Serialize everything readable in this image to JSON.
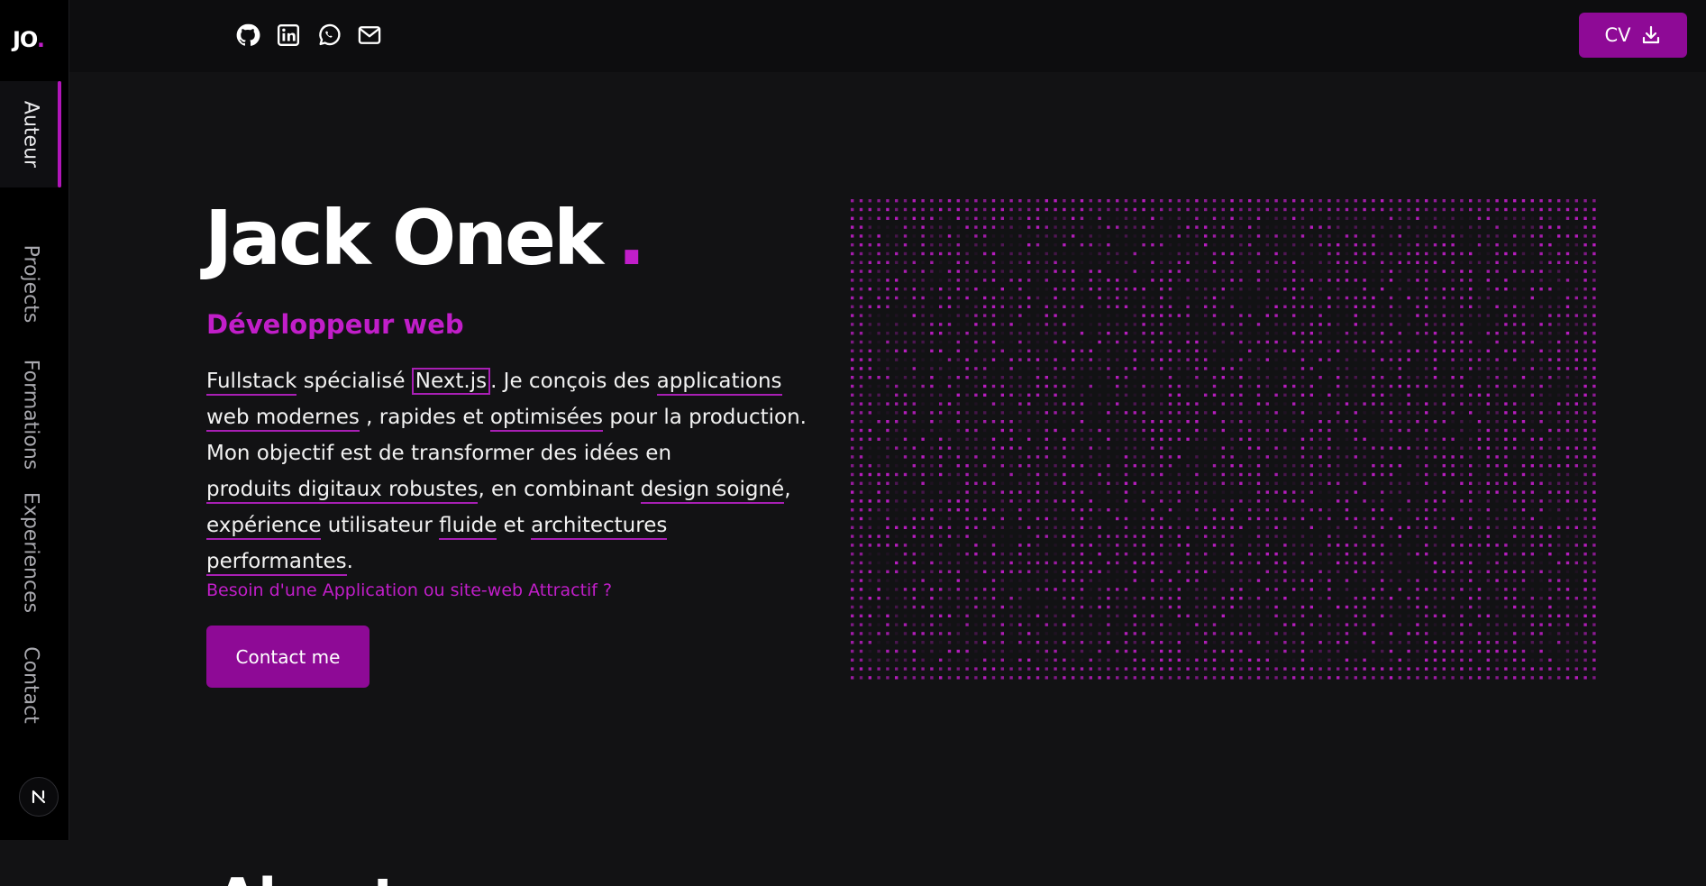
{
  "logo": {
    "text": "JO",
    "dot": "."
  },
  "sidebar": {
    "items": [
      {
        "label": "Auteur",
        "active": true
      },
      {
        "label": "Projects",
        "active": false
      },
      {
        "label": "Formations",
        "active": false
      },
      {
        "label": "Experiences",
        "active": false
      },
      {
        "label": "Contact",
        "active": false
      }
    ],
    "theme_toggle_icon": "nextjs-icon"
  },
  "header": {
    "social_icons": [
      "github-icon",
      "linkedin-icon",
      "whatsapp-icon",
      "mail-icon"
    ],
    "cv_label": "CV",
    "cv_icon": "download-icon"
  },
  "hero": {
    "name": "Jack Onek",
    "name_dot": ".",
    "subtitle": "Développeur web",
    "bio": [
      "Fullstack",
      " spécialisé ",
      "Next.js",
      ". Je conçois des ",
      "applications web modernes",
      " , rapides et ",
      "optimisées",
      " pour la production. Mon objectif est de transformer des idées en ",
      "produits digitaux robustes",
      ", en combinant ",
      "design soigné",
      ",",
      "expérience",
      " utilisateur ",
      "fluide",
      " et ",
      "architectures performantes",
      "."
    ],
    "tagline": "Besoin d'une Application ou site-web Attractif ?",
    "contact_label": "Contact me"
  },
  "about_peek": "About",
  "colors": {
    "accent": "#c11ec9",
    "button": "#8e0a96",
    "background": "#121214",
    "sidebar": "#000000"
  }
}
